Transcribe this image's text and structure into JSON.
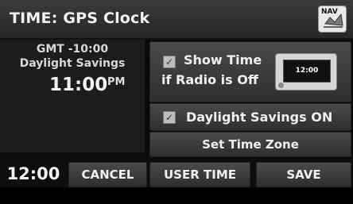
{
  "header": {
    "title": "TIME: GPS Clock",
    "nav_label": "NAV"
  },
  "clock_info": {
    "gmt": "GMT -10:00",
    "daylight_label": "Daylight Savings",
    "time": "11:00",
    "meridiem": "PM"
  },
  "options": {
    "show_time_line1": "Show Time",
    "show_time_line2": "if Radio is Off",
    "show_time_checked": true,
    "radio_preview_time": "12:00",
    "daylight_savings_label": "Daylight Savings ON",
    "daylight_savings_checked": true,
    "set_time_zone_label": "Set Time Zone"
  },
  "footer": {
    "clock": "12:00",
    "cancel_label": "CANCEL",
    "user_time_label": "USER TIME",
    "save_label": "SAVE"
  },
  "icons": {
    "nav": "nav-map-icon",
    "checkbox": "checkmark-icon",
    "radio": "radio-display-icon"
  }
}
